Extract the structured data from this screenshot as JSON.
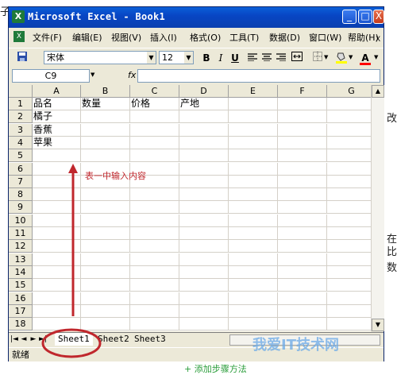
{
  "window": {
    "title": "Microsoft Excel - Book1",
    "app_icon_glyph": "X",
    "minimize_glyph": "_",
    "maximize_glyph": "□",
    "close_glyph": "X"
  },
  "menu": {
    "items": [
      "文件(F)",
      "编辑(E)",
      "视图(V)",
      "插入(I)",
      "格式(O)",
      "工具(T)",
      "数据(D)",
      "窗口(W)",
      "帮助(H)"
    ],
    "doc_close_glyph": "X"
  },
  "toolbar": {
    "font_name": "宋体",
    "font_size": "12",
    "bold_label": "B",
    "italic_label": "I",
    "underline_label": "U",
    "font_color_label": "A",
    "fill_color": "#ffff00",
    "font_color": "#ff0000"
  },
  "formula_bar": {
    "name_box": "C9",
    "fx_label": "fx",
    "content": ""
  },
  "grid": {
    "columns": [
      "A",
      "B",
      "C",
      "D",
      "E",
      "F",
      "G"
    ],
    "rows": [
      "1",
      "2",
      "3",
      "4",
      "5",
      "6",
      "7",
      "8",
      "9",
      "10",
      "11",
      "12",
      "13",
      "14",
      "15",
      "16",
      "17",
      "18"
    ],
    "cells": {
      "A1": "品名",
      "B1": "数量",
      "C1": "价格",
      "D1": "产地",
      "A2": "橘子",
      "A3": "香蕉",
      "A4": "苹果"
    }
  },
  "sheets": {
    "tabs": [
      "Sheet1",
      "Sheet2",
      "Sheet3"
    ],
    "active": "Sheet1"
  },
  "status": {
    "text": "就绪"
  },
  "annotation": {
    "text": "表一中输入内容",
    "color": "#c0272d"
  },
  "page_extras": {
    "left_edge_char": "子",
    "right_edge_chars": [
      "改",
      "在",
      "比",
      "数"
    ],
    "watermark": "我爱IT技术网",
    "add_steps": "+ 添加步骤方法"
  }
}
